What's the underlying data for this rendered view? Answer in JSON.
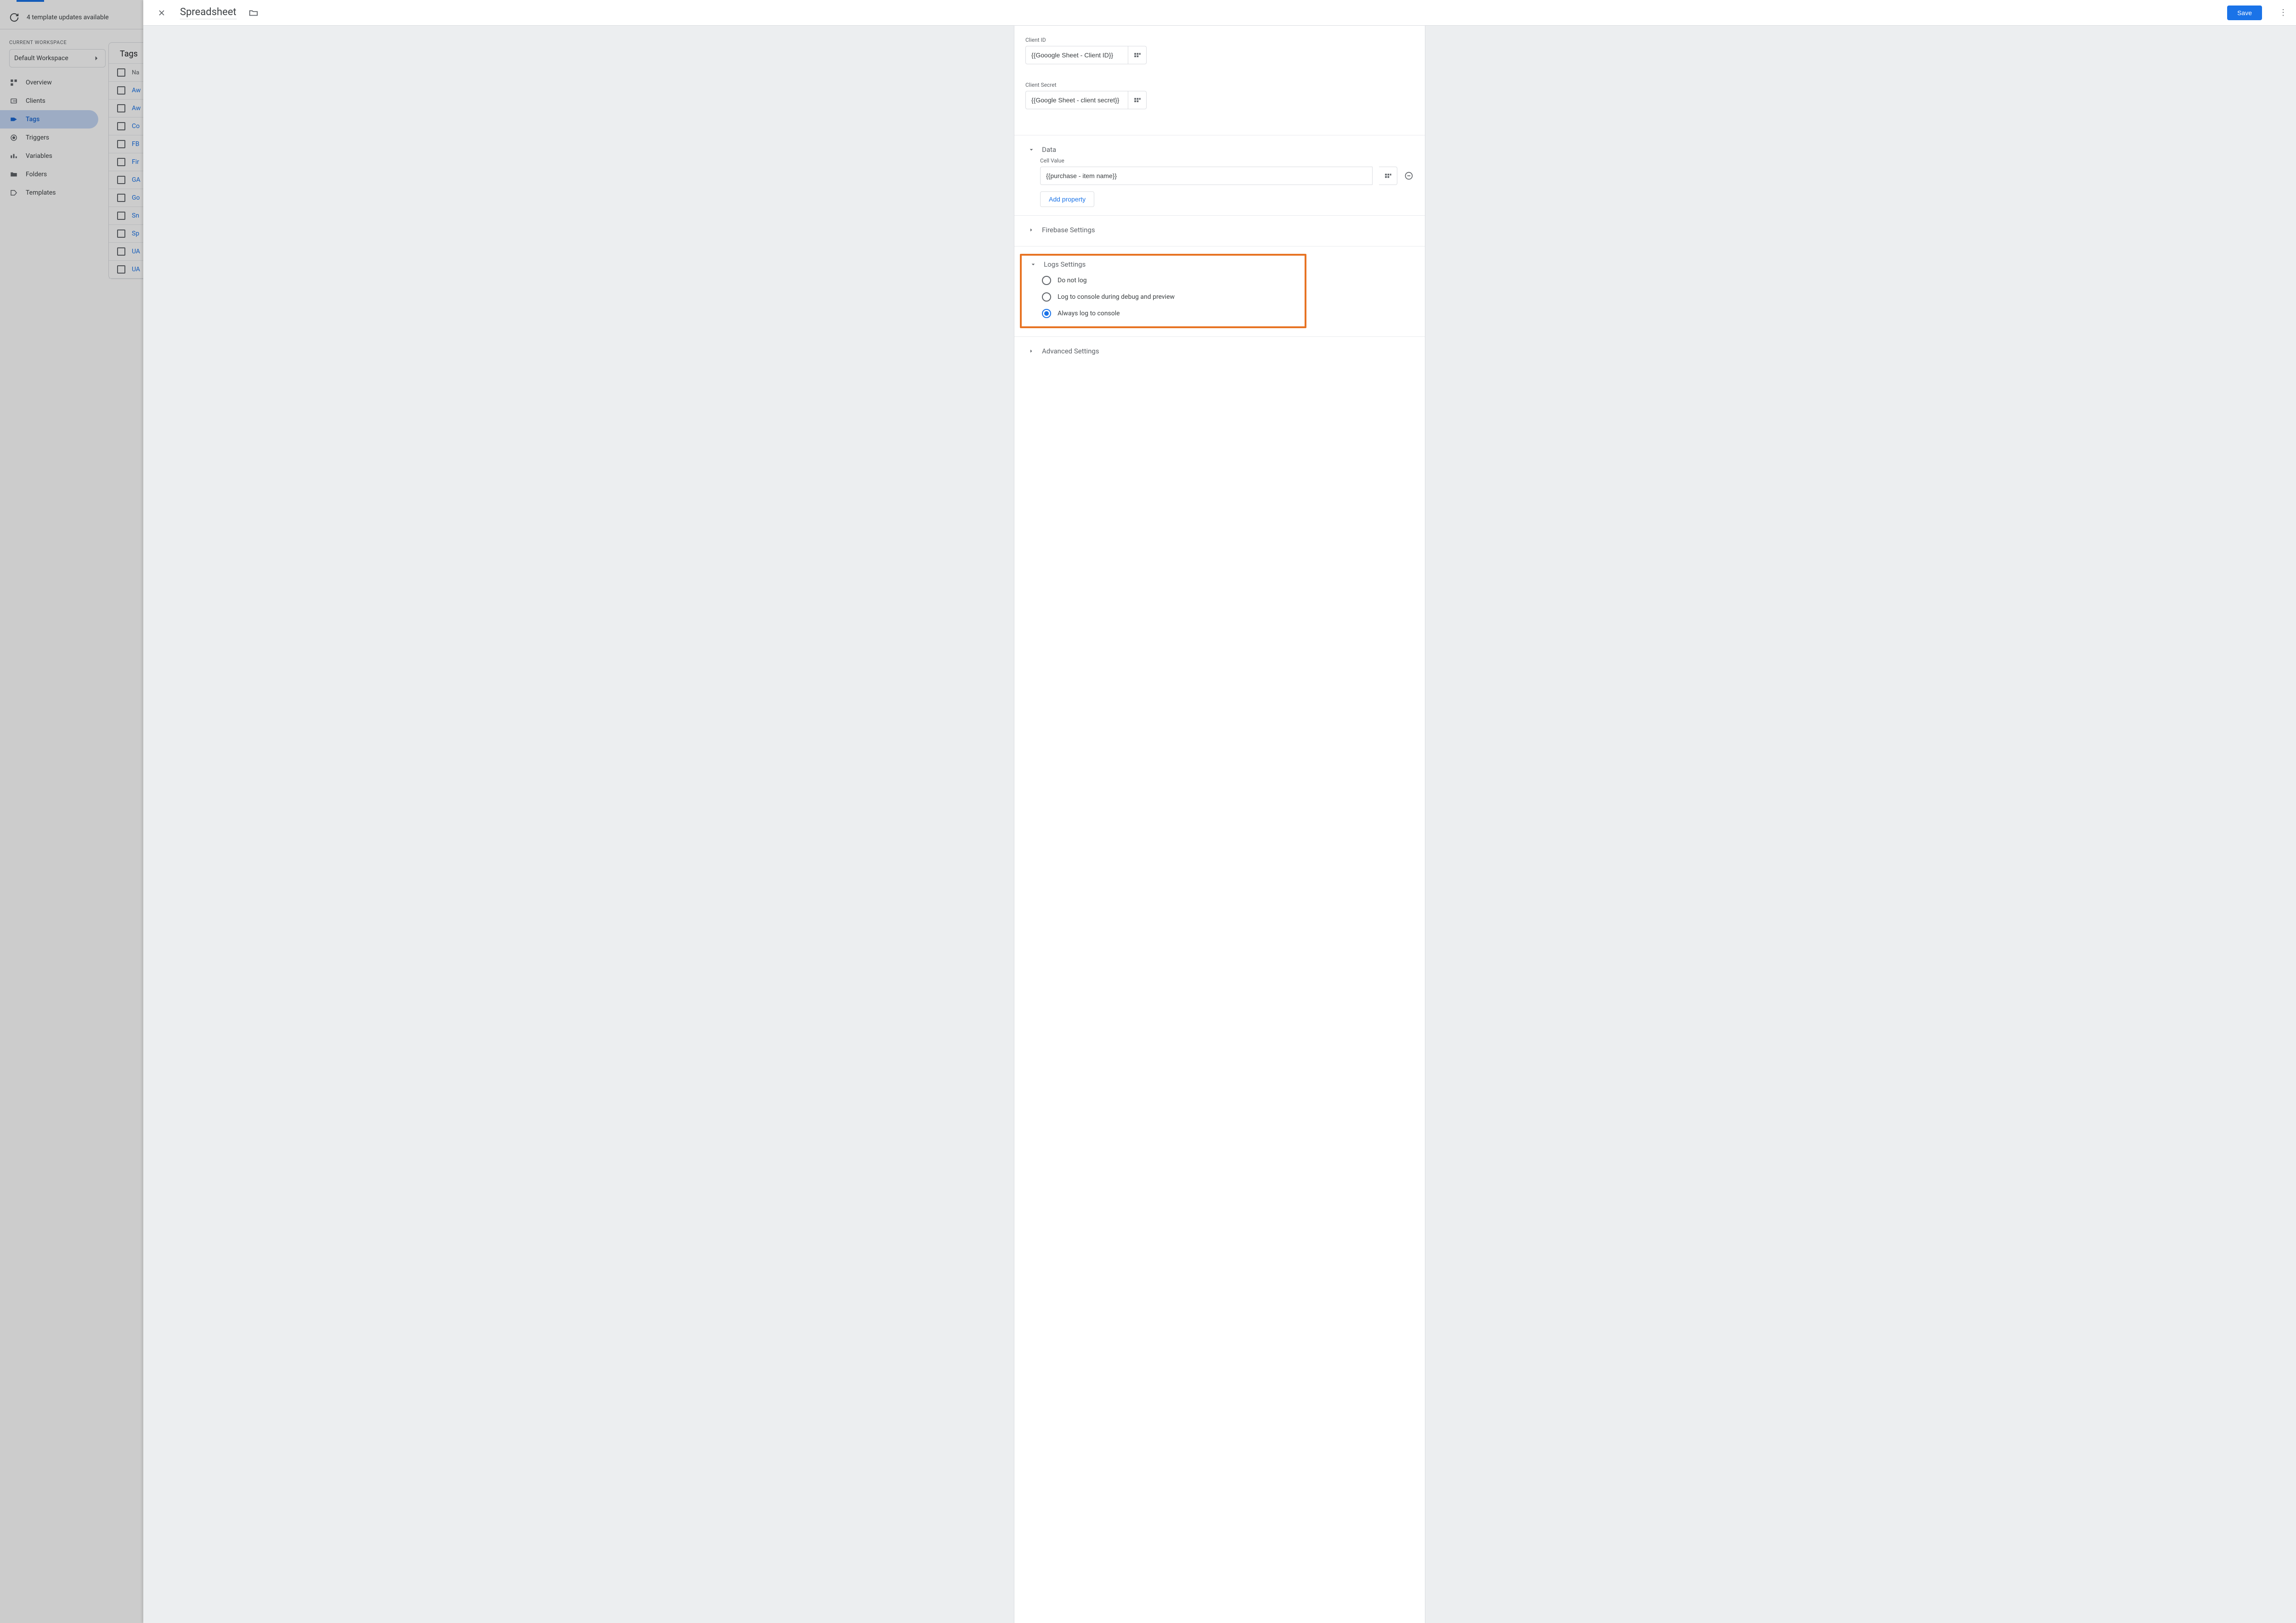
{
  "update_bar": {
    "text": "4 template updates available"
  },
  "workspace": {
    "label": "CURRENT WORKSPACE",
    "name": "Default Workspace"
  },
  "sidebar": {
    "items": [
      {
        "label": "Overview"
      },
      {
        "label": "Clients"
      },
      {
        "label": "Tags"
      },
      {
        "label": "Triggers"
      },
      {
        "label": "Variables"
      },
      {
        "label": "Folders"
      },
      {
        "label": "Templates"
      }
    ]
  },
  "tags_panel": {
    "title": "Tags",
    "col_name": "Na",
    "rows": [
      "Aw",
      "Aw",
      "Co",
      "FB",
      "Fir",
      "GA",
      "Go",
      "Sn",
      "Sp",
      "UA",
      "UA"
    ]
  },
  "overlay": {
    "title": "Spreadsheet",
    "save": "Save",
    "client_id": {
      "label": "Client ID",
      "value": "{{Gooogle Sheet - Client ID}}"
    },
    "client_secret": {
      "label": "Client Secret",
      "value": "{{Google Sheet - client secret}}"
    },
    "data": {
      "heading": "Data",
      "cell_value_label": "Cell Value",
      "cell_value": "{{purchase - item name}}",
      "add_property": "Add property"
    },
    "firebase": {
      "heading": "Firebase Settings"
    },
    "logs": {
      "heading": "Logs Settings",
      "options": [
        {
          "label": "Do not log",
          "selected": false
        },
        {
          "label": "Log to console during debug and preview",
          "selected": false
        },
        {
          "label": "Always log to console",
          "selected": true
        }
      ]
    },
    "advanced": {
      "heading": "Advanced Settings"
    }
  }
}
